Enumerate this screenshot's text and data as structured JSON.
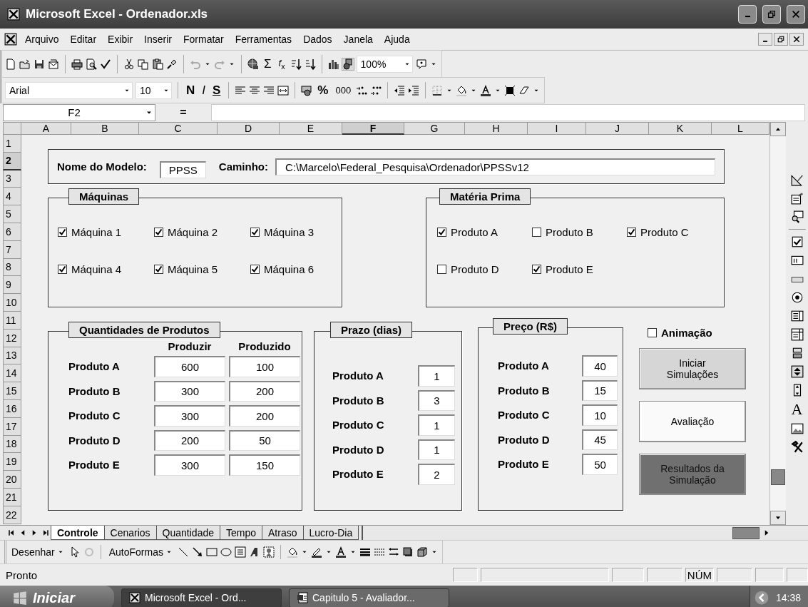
{
  "window": {
    "title": "Microsoft Excel - Ordenador.xls"
  },
  "menu": [
    "Arquivo",
    "Editar",
    "Exibir",
    "Inserir",
    "Formatar",
    "Ferramentas",
    "Dados",
    "Janela",
    "Ajuda"
  ],
  "standard_toolbar": {
    "autosum": "Σ",
    "function": "*f*$_{x}$",
    "zoom": "100%"
  },
  "formatting_toolbar": {
    "font": "Arial",
    "size": "10",
    "bold": "N",
    "italic": "I",
    "underline": "S",
    "percent": "%",
    "thousands": "000"
  },
  "formula_bar": {
    "name_box": "F2",
    "equals": "="
  },
  "columns": [
    {
      "label": "A",
      "selected": false
    },
    {
      "label": "B",
      "selected": false
    },
    {
      "label": "C",
      "selected": false
    },
    {
      "label": "D",
      "selected": false
    },
    {
      "label": "E",
      "selected": false
    },
    {
      "label": "F",
      "selected": true
    },
    {
      "label": "G",
      "selected": false
    },
    {
      "label": "H",
      "selected": false
    },
    {
      "label": "I",
      "selected": false
    },
    {
      "label": "J",
      "selected": false
    },
    {
      "label": "K",
      "selected": false
    },
    {
      "label": "L",
      "selected": false
    }
  ],
  "rows": [
    {
      "label": "1",
      "selected": false
    },
    {
      "label": "2",
      "selected": true
    },
    {
      "label": "3",
      "selected": false
    },
    {
      "label": "4",
      "selected": false
    },
    {
      "label": "5",
      "selected": false
    },
    {
      "label": "6",
      "selected": false
    },
    {
      "label": "7",
      "selected": false
    },
    {
      "label": "8",
      "selected": false
    },
    {
      "label": "9",
      "selected": false
    },
    {
      "label": "10",
      "selected": false
    },
    {
      "label": "11",
      "selected": false
    },
    {
      "label": "12",
      "selected": false
    },
    {
      "label": "13",
      "selected": false
    },
    {
      "label": "14",
      "selected": false
    },
    {
      "label": "15",
      "selected": false
    },
    {
      "label": "16",
      "selected": false
    },
    {
      "label": "17",
      "selected": false
    },
    {
      "label": "18",
      "selected": false
    },
    {
      "label": "19",
      "selected": false
    },
    {
      "label": "20",
      "selected": false
    },
    {
      "label": "21",
      "selected": false
    },
    {
      "label": "22",
      "selected": false
    }
  ],
  "form": {
    "model_label": "Nome do Modelo:",
    "model": "PPSS",
    "path_label": "Caminho:",
    "path": "C:\\Marcelo\\Federal_Pesquisa\\Ordenador\\PPSSv12",
    "machines": {
      "title": "Máquinas",
      "items": [
        {
          "label": "Máquina 1",
          "checked": true
        },
        {
          "label": "Máquina 2",
          "checked": true
        },
        {
          "label": "Máquina 3",
          "checked": true
        },
        {
          "label": "Máquina 4",
          "checked": true
        },
        {
          "label": "Máquina 5",
          "checked": true
        },
        {
          "label": "Máquina 6",
          "checked": true
        }
      ]
    },
    "materials": {
      "title": "Matéria Prima",
      "items": [
        {
          "label": "Produto A",
          "checked": true
        },
        {
          "label": "Produto B",
          "checked": false
        },
        {
          "label": "Produto C",
          "checked": true
        },
        {
          "label": "Produto D",
          "checked": false
        },
        {
          "label": "Produto E",
          "checked": true
        }
      ]
    },
    "quantities": {
      "title": "Quantidades de Produtos",
      "headers": [
        "Produzir",
        "Produzido"
      ],
      "rows": [
        {
          "product": "Produto A",
          "produce": "600",
          "produced": "100"
        },
        {
          "product": "Produto B",
          "produce": "300",
          "produced": "200"
        },
        {
          "product": "Produto C",
          "produce": "300",
          "produced": "200"
        },
        {
          "product": "Produto D",
          "produce": "200",
          "produced": "50"
        },
        {
          "product": "Produto E",
          "produce": "300",
          "produced": "150"
        }
      ]
    },
    "deadlines": {
      "title": "Prazo (dias)",
      "rows": [
        {
          "product": "Produto A",
          "value": "1"
        },
        {
          "product": "Produto B",
          "value": "3"
        },
        {
          "product": "Produto C",
          "value": "1"
        },
        {
          "product": "Produto D",
          "value": "1"
        },
        {
          "product": "Produto E",
          "value": "2"
        }
      ]
    },
    "prices": {
      "title": "Preço (R$)",
      "rows": [
        {
          "product": "Produto A",
          "value": "40"
        },
        {
          "product": "Produto B",
          "value": "15"
        },
        {
          "product": "Produto C",
          "value": "10"
        },
        {
          "product": "Produto D",
          "value": "45"
        },
        {
          "product": "Produto E",
          "value": "50"
        }
      ]
    },
    "animation": {
      "label": "Animação",
      "checked": false
    },
    "buttons": [
      {
        "label": "Iniciar Simulações",
        "kind": "light"
      },
      {
        "label": "Avaliação",
        "kind": "white"
      },
      {
        "label": "Resultados da Simulação",
        "kind": "dark"
      }
    ]
  },
  "control_toolbar": {
    "label_glyph": "A"
  },
  "sheet_tabs": [
    {
      "label": "Controle",
      "selected": true
    },
    {
      "label": "Cenarios",
      "selected": false
    },
    {
      "label": "Quantidade",
      "selected": false
    },
    {
      "label": "Tempo",
      "selected": false
    },
    {
      "label": "Atraso",
      "selected": false
    },
    {
      "label": "Lucro-Dia",
      "selected": false
    }
  ],
  "drawing_toolbar": {
    "draw": "Desenhar",
    "autoshapes": "AutoFormas"
  },
  "status_bar": {
    "text": "Pronto",
    "num": "NÚM"
  },
  "taskbar": {
    "start": "Iniciar",
    "tasks": [
      {
        "label": "Microsoft Excel - Ord...",
        "selected": true
      },
      {
        "label": "Capitulo 5 - Avaliador...",
        "selected": false
      }
    ],
    "clock": "14:38"
  }
}
